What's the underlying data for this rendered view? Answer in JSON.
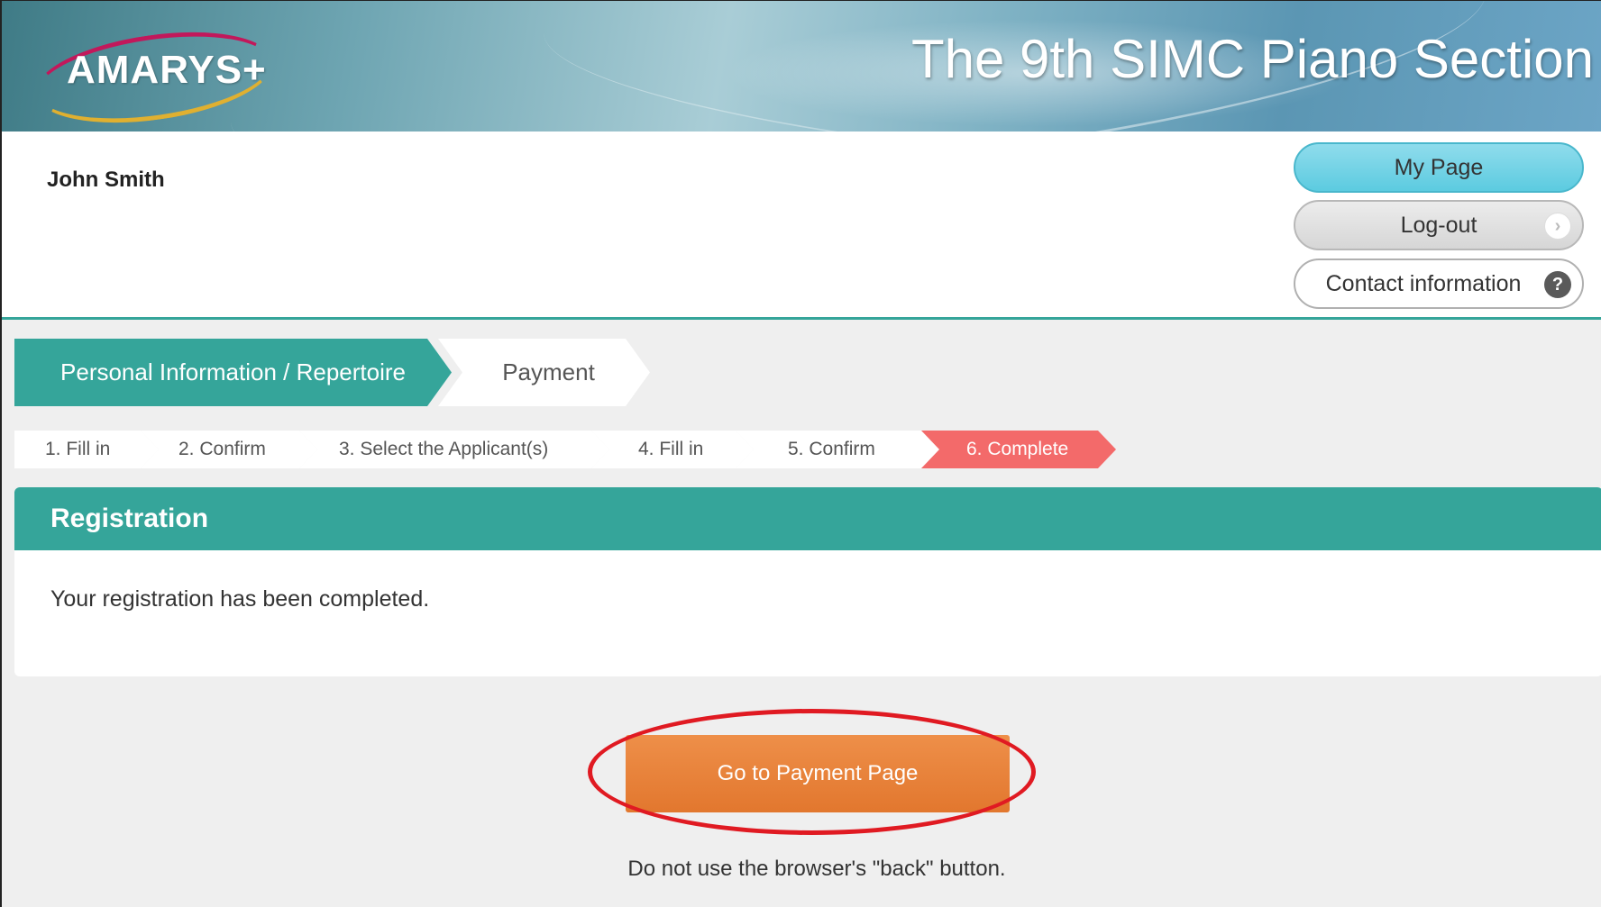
{
  "banner": {
    "logo_text": "AMARYS+",
    "title": "The 9th SIMC Piano Section"
  },
  "header": {
    "user_name": "John Smith",
    "buttons": {
      "my_page": "My Page",
      "logout": "Log-out",
      "contact": "Contact information"
    },
    "icons": {
      "logout": "chevron-right-icon",
      "contact": "question-icon"
    }
  },
  "phases": [
    {
      "label": "Personal Information / Repertoire",
      "active": true
    },
    {
      "label": "Payment",
      "active": false
    }
  ],
  "steps": [
    {
      "label": "1.  Fill in"
    },
    {
      "label": "2.  Confirm"
    },
    {
      "label": "3.  Select the Applicant(s)"
    },
    {
      "label": "4.  Fill in"
    },
    {
      "label": "5.  Confirm"
    },
    {
      "label": "6.  Complete",
      "active": true
    }
  ],
  "card": {
    "title": "Registration",
    "message": "Your registration has been completed."
  },
  "payment_button": "Go to Payment Page",
  "warning": "Do not use the browser's \"back\" button.",
  "colors": {
    "teal": "#35a59a",
    "active_step": "#f36a6a",
    "payment_button": "#e2772e",
    "annotation_ring": "#e01a22"
  }
}
